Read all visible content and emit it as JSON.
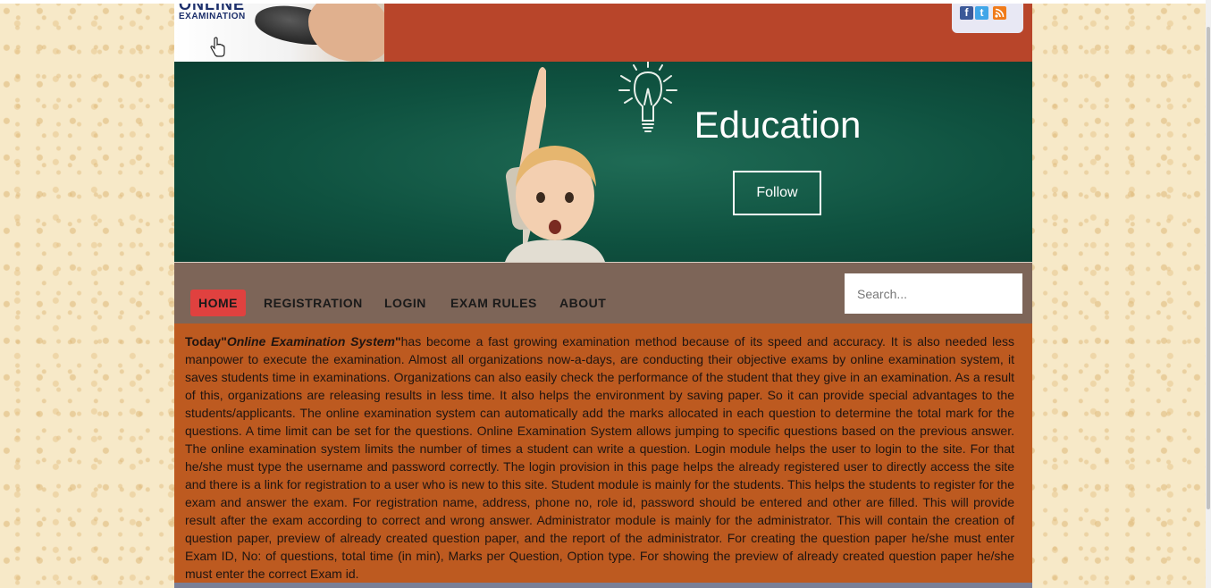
{
  "header": {
    "logo_line1": "ONLINE",
    "logo_line2": "EXAMINATION",
    "social": [
      "facebook-icon",
      "twitter-icon",
      "rss-icon"
    ]
  },
  "hero": {
    "title": "Education",
    "follow_label": "Follow"
  },
  "nav": {
    "items": [
      {
        "label": "HOME",
        "active": true
      },
      {
        "label": "REGISTRATION",
        "active": false
      },
      {
        "label": "LOGIN",
        "active": false
      },
      {
        "label": "EXAM RULES",
        "active": false
      },
      {
        "label": "ABOUT",
        "active": false
      }
    ],
    "search_placeholder": "Search..."
  },
  "content": {
    "lead": "Today\"",
    "system_name": "Online Examination System",
    "quote_close": "\"",
    "body": "has become a fast growing examination method because of its speed and accuracy. It is also needed less manpower to execute the examination. Almost all organizations now-a-days, are conducting their objective exams by online examination system, it saves students time in examinations. Organizations can also easily check the performance of the student that they give in an examination. As a result of this, organizations are releasing results in less time. It also helps the environment by saving paper. So it can provide special advantages to the students/applicants. The online examination system can automatically add the marks allocated in each question to determine the total mark for the questions. A time limit can be set for the questions. Online Examination System allows jumping to specific questions based on the previous answer. The online examination system limits the number of times a student can write a question. Login module helps the user to login to the site. For that he/she must type the username and password correctly. The login provision in this page helps the already registered user to directly access the site and there is a link for registration to a user who is new to this site. Student module is mainly for the students. This helps the students to register for the exam and answer the exam. For registration name, address, phone no, role id, password should be entered and other are filled. This will provide result after the exam according to correct and wrong answer. Administrator module is mainly for the administrator. This will contain the creation of question paper, preview of already created question paper, and the report of the administrator. For creating the question paper he/she must enter Exam ID, No: of questions, total time (in min), Marks per Question, Option type. For showing the preview of already created question paper he/she must enter the correct Exam id."
  },
  "colors": {
    "header_bg": "#b8452a",
    "nav_bg": "#7d6558",
    "nav_active": "#e0413f",
    "content_bg": "#bd5a20",
    "hero_bg": "#0f5240"
  }
}
